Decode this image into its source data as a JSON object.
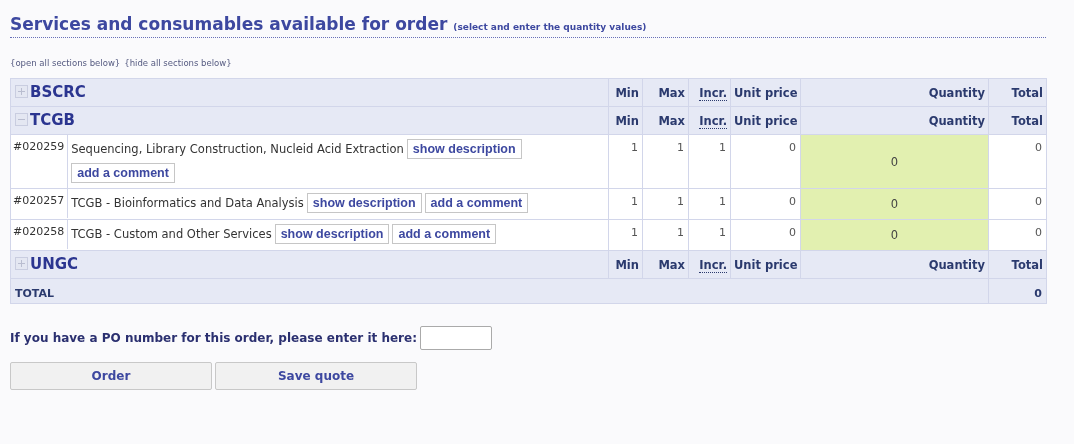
{
  "heading": {
    "title": "Services and consumables available for order",
    "hint": "(select and enter the quantity values)"
  },
  "section_links": [
    "{open all sections below}",
    "{hide all sections below}"
  ],
  "sections": [
    {
      "name": "BSCRC",
      "expanded": false,
      "columns": [
        "Min",
        "Max",
        "Incr.",
        "Unit price",
        "Quantity",
        "Total"
      ]
    },
    {
      "name": "TCGB",
      "expanded": true,
      "columns": [
        "Min",
        "Max",
        "Incr.",
        "Unit price",
        "Quantity",
        "Total"
      ],
      "items": [
        {
          "id": "#020259",
          "name": "Sequencing, Library Construction, Nucleid Acid Extraction",
          "buttons": [
            "show description",
            "add a comment"
          ],
          "min": "1",
          "max": "1",
          "incr": "1",
          "unit_price": "0",
          "quantity": "0",
          "total": "0"
        },
        {
          "id": "#020257",
          "name": "TCGB - Bioinformatics and Data Analysis",
          "buttons": [
            "show description",
            "add a comment"
          ],
          "min": "1",
          "max": "1",
          "incr": "1",
          "unit_price": "0",
          "quantity": "0",
          "total": "0"
        },
        {
          "id": "#020258",
          "name": "TCGB - Custom and Other Services",
          "buttons": [
            "show description",
            "add a comment"
          ],
          "min": "1",
          "max": "1",
          "incr": "1",
          "unit_price": "0",
          "quantity": "0",
          "total": "0"
        }
      ]
    },
    {
      "name": "UNGC",
      "expanded": false,
      "columns": [
        "Min",
        "Max",
        "Incr.",
        "Unit price",
        "Quantity",
        "Total"
      ]
    }
  ],
  "total": {
    "label": "TOTAL",
    "value": "0"
  },
  "po": {
    "label": "If you have a PO number for this order, please enter it here:"
  },
  "buttons": [
    "Order",
    "Save quote"
  ]
}
